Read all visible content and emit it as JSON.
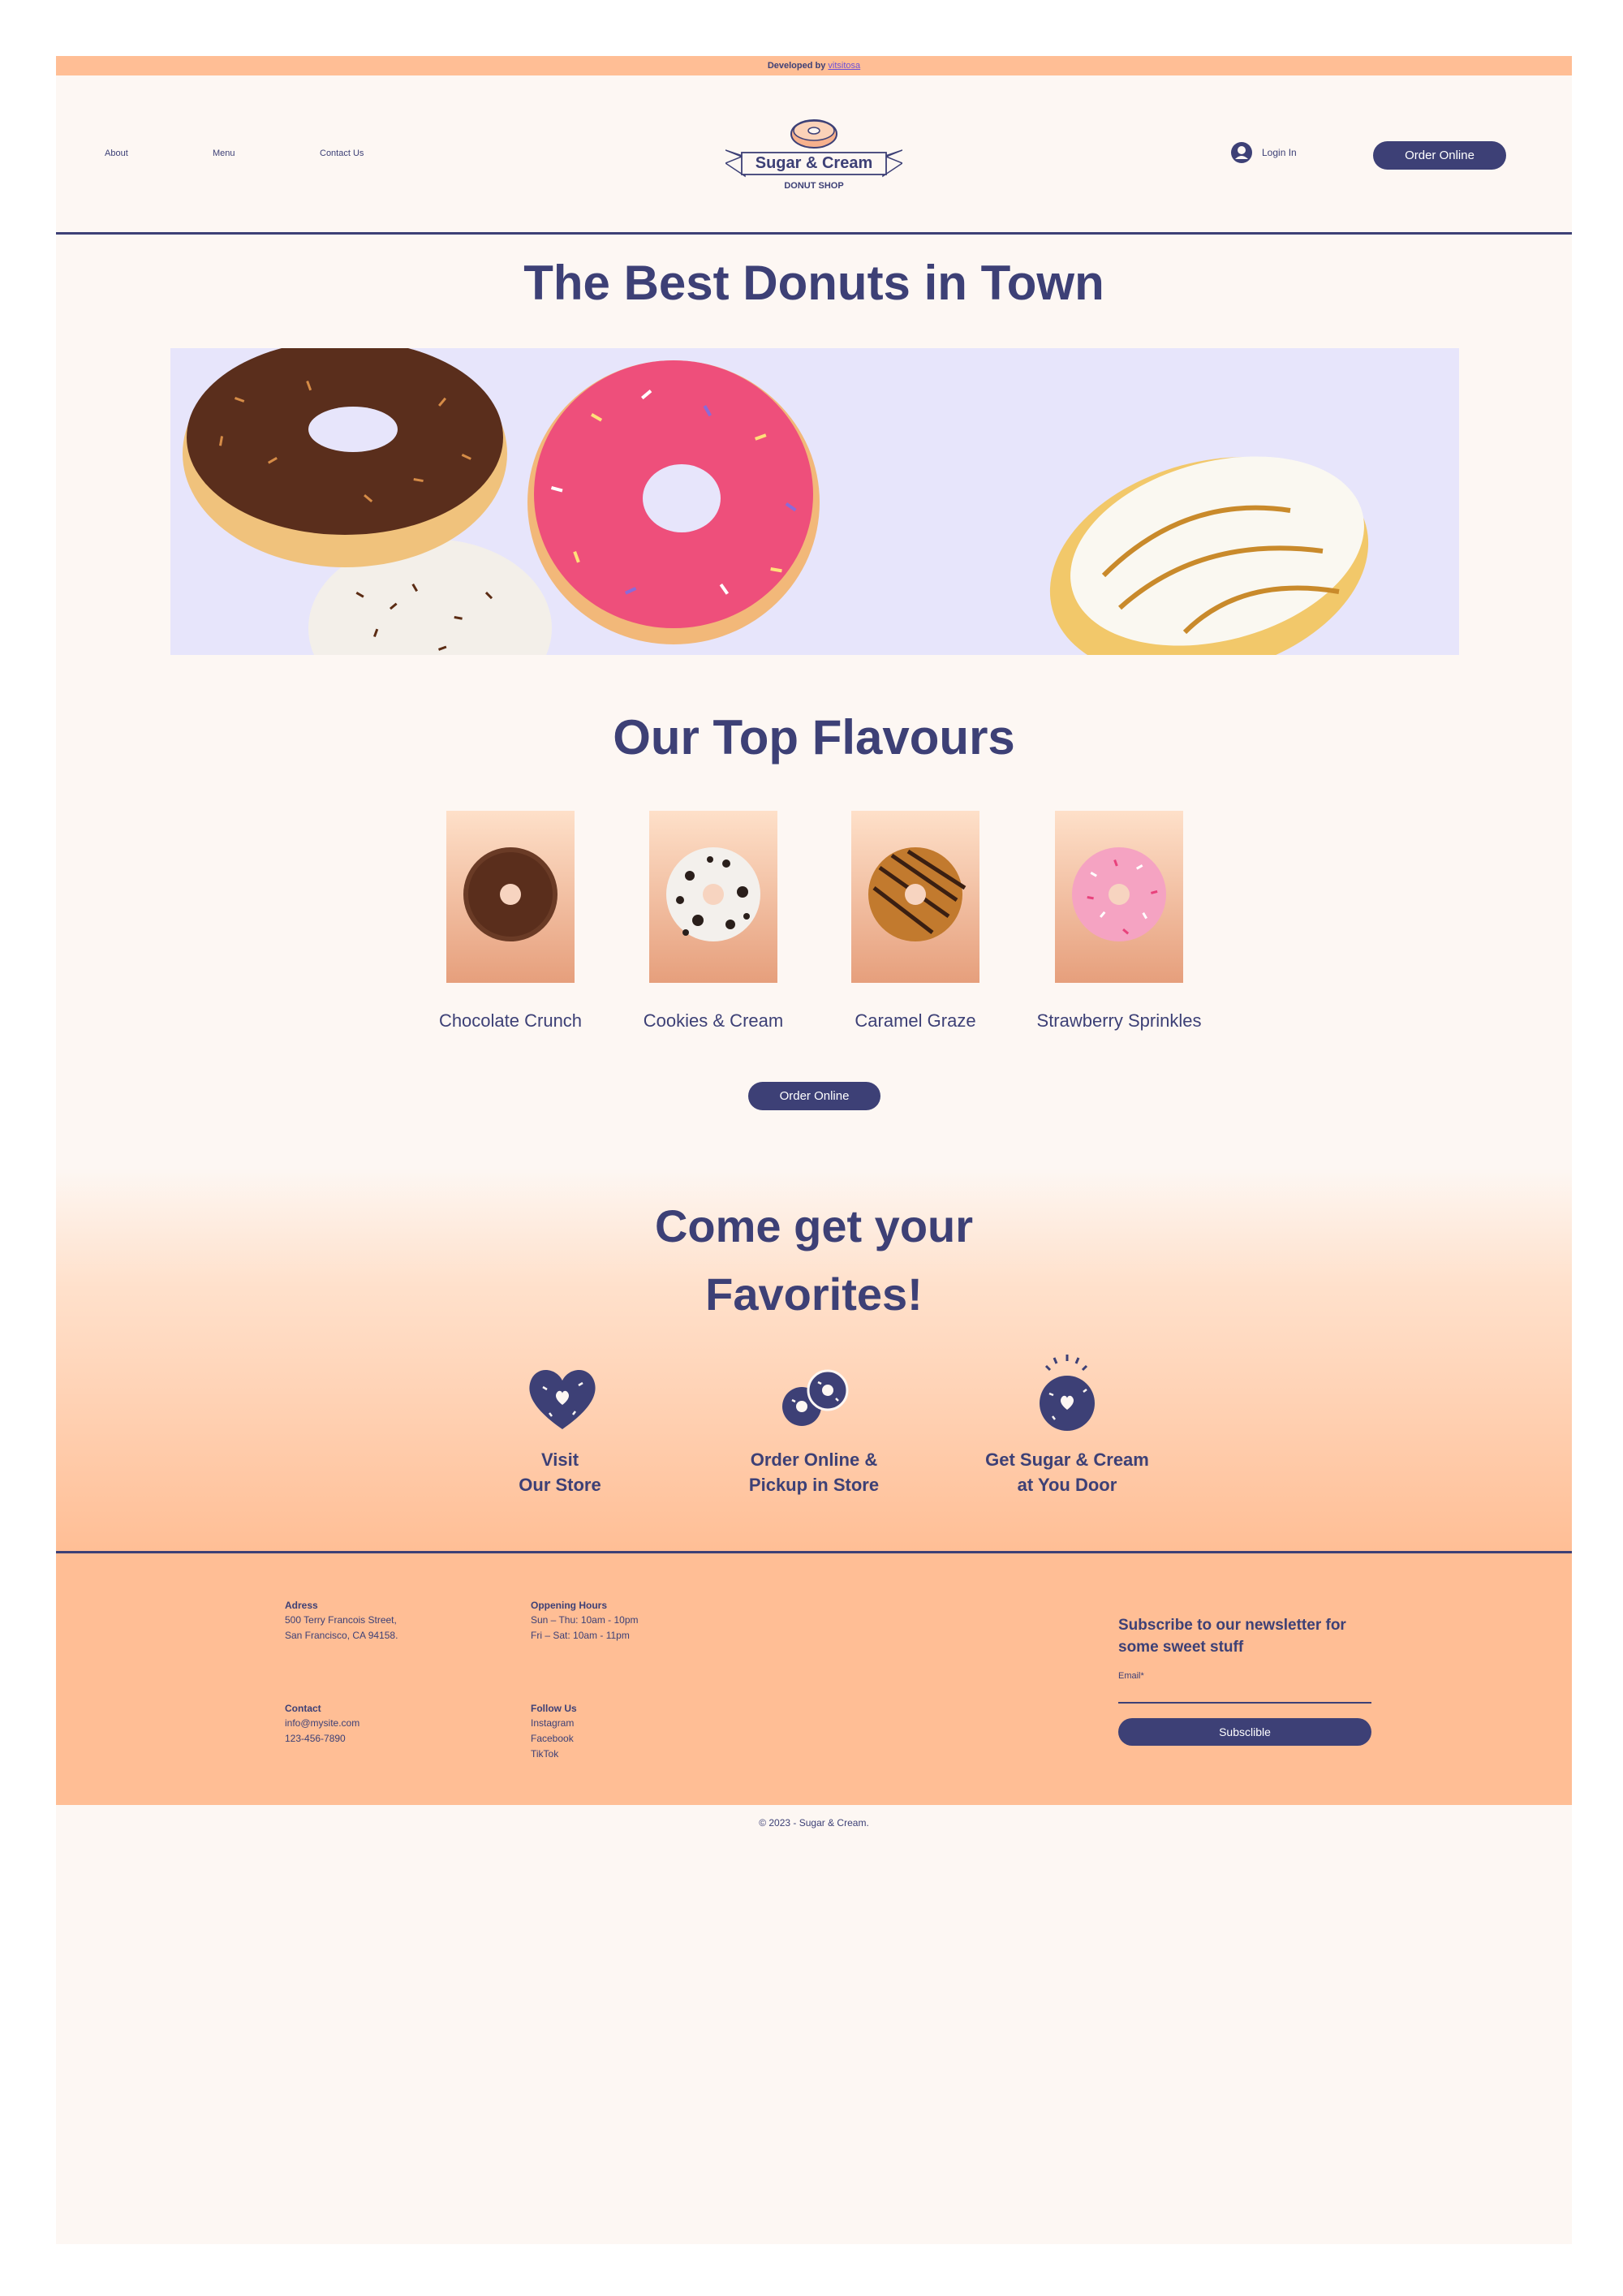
{
  "topbar": {
    "prefix": "Developed by",
    "link": "vitsitosa"
  },
  "nav": {
    "about": "About",
    "menu": "Menu",
    "contact": "Contact Us"
  },
  "logo": {
    "name": "Sugar & Cream",
    "tagline": "DONUT SHOP"
  },
  "header": {
    "login": "Login In",
    "order": "Order Online"
  },
  "hero": {
    "title": "The Best Donuts in Town"
  },
  "flavours": {
    "title": "Our Top Flavours",
    "items": [
      {
        "label": "Chocolate Crunch"
      },
      {
        "label": "Cookies & Cream"
      },
      {
        "label": "Caramel Graze"
      },
      {
        "label": "Strawberry Sprinkles"
      }
    ],
    "order": "Order Online"
  },
  "favorites": {
    "title_line1": "Come get your",
    "title_line2": "Favorites!",
    "items": [
      {
        "line1": "Visit",
        "line2": "Our Store"
      },
      {
        "line1": "Order Online &",
        "line2": "Pickup in Store"
      },
      {
        "line1": "Get Sugar & Cream",
        "line2": "at You Door"
      }
    ]
  },
  "footer": {
    "address_h": "Adress",
    "address_1": "500 Terry Francois Street,",
    "address_2": "San Francisco, CA 94158.",
    "hours_h": "Oppening Hours",
    "hours_1": "Sun – Thu: 10am - 10pm",
    "hours_2": "Fri – Sat: 10am - 11pm",
    "contact_h": "Contact",
    "contact_1": "info@mysite.com",
    "contact_2": "123-456-7890",
    "follow_h": "Follow Us",
    "follow_1": "Instagram",
    "follow_2": "Facebook",
    "follow_3": "TikTok",
    "news_title": "Subscribe to our newsletter for some sweet stuff",
    "email_label": "Email*",
    "subscribe": "Subsclible",
    "copyright": "© 2023 - Sugar & Cream."
  },
  "colors": {
    "brand": "#3d4076",
    "peach": "#ffbe95",
    "bg": "#fdf7f3",
    "hero_bg": "#e7e5fb"
  }
}
